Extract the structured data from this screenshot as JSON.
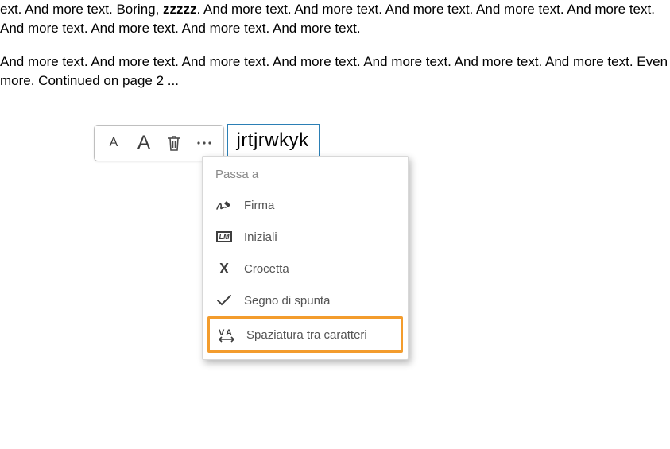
{
  "document": {
    "p1": "ext. And more text. Boring, zzzzz. And more text. And more text. And more text. And more text. And more text. And more text. And more text. And more text. And more text.",
    "bold_word": "zzzzz",
    "p2": "And more text. And more text. And more text. And more text. And more text. And more text. And more text. Even more. Continued on page 2 ..."
  },
  "toolbar": {
    "small_a": "A",
    "big_a": "A"
  },
  "input": {
    "value": "jrtjrwkyk"
  },
  "menu": {
    "header": "Passa a",
    "items": [
      {
        "id": "firma",
        "label": "Firma",
        "icon": "signature-icon"
      },
      {
        "id": "iniziali",
        "label": "Iniziali",
        "icon": "initials-icon"
      },
      {
        "id": "crocetta",
        "label": "Crocetta",
        "icon": "x-icon"
      },
      {
        "id": "spunta",
        "label": "Segno di spunta",
        "icon": "check-icon"
      },
      {
        "id": "spaziatura",
        "label": "Spaziatura tra caratteri",
        "icon": "kerning-icon",
        "highlight": true
      }
    ],
    "initials_text": "LM"
  },
  "colors": {
    "highlight_border": "#f39c2d",
    "input_border": "#2b7fb5"
  }
}
